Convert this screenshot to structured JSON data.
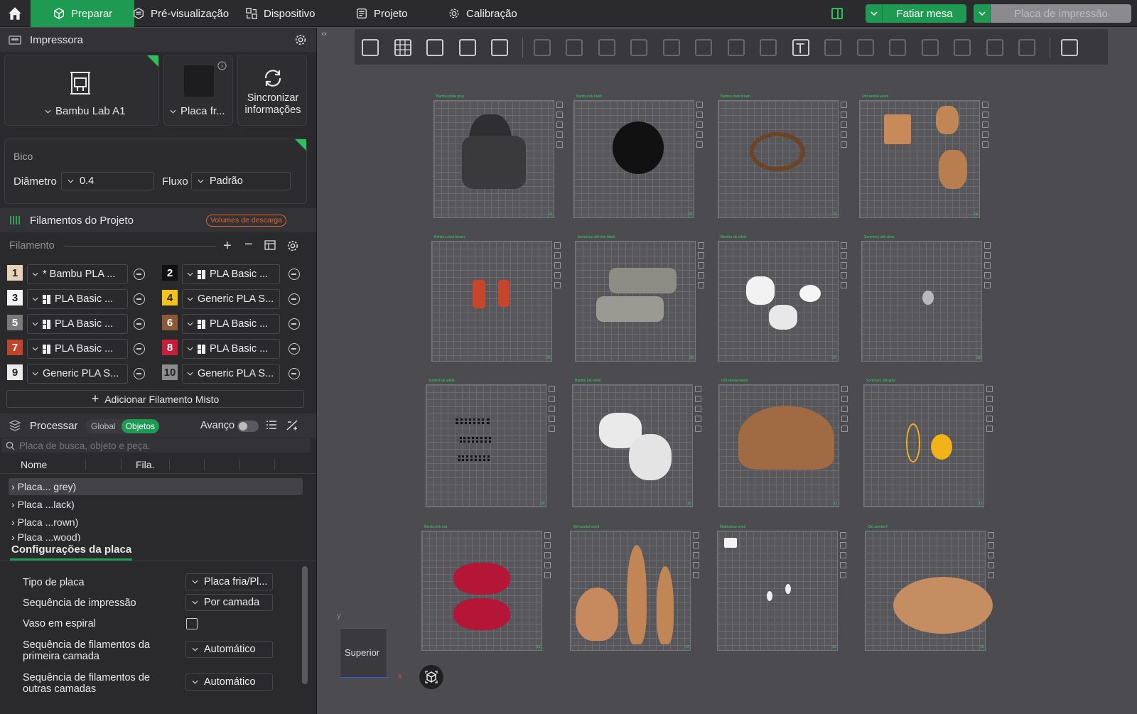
{
  "topbar": {
    "tabs": [
      {
        "label": "Preparar"
      },
      {
        "label": "Pré-visualização"
      },
      {
        "label": "Dispositivo"
      },
      {
        "label": "Projeto"
      },
      {
        "label": "Calibração"
      }
    ],
    "slice_label": "Fatiar mesa",
    "print_label": "Placa de impressão"
  },
  "printer": {
    "header": "Impressora",
    "name": "Bambu Lab A1",
    "plate": "Placa fr...",
    "sync": "Sincronizar informações"
  },
  "nozzle": {
    "title": "Bico",
    "diameter_label": "Diâmetro",
    "diameter_value": "0.4",
    "flow_label": "Fluxo",
    "flow_value": "Padrão"
  },
  "filaments": {
    "header": "Filamentos do Projeto",
    "badge": "Volumes de descarga",
    "sub_label": "Filamento",
    "add_mixed": "Adicionar Filamento Misto",
    "items": [
      {
        "n": "1",
        "name": "* Bambu PLA ...",
        "color": "#e7d3b8",
        "fg": "#222",
        "icon": false
      },
      {
        "n": "2",
        "name": "PLA Basic ...",
        "color": "#101010",
        "fg": "#fff",
        "icon": true
      },
      {
        "n": "3",
        "name": "PLA Basic ...",
        "color": "#f3f3f3",
        "fg": "#222",
        "icon": true
      },
      {
        "n": "4",
        "name": "Generic PLA S...",
        "color": "#f3c21b",
        "fg": "#222",
        "icon": false
      },
      {
        "n": "5",
        "name": "PLA Basic ...",
        "color": "#7a7a7a",
        "fg": "#fff",
        "icon": true
      },
      {
        "n": "6",
        "name": "PLA Basic ...",
        "color": "#8a5a36",
        "fg": "#fff",
        "icon": true
      },
      {
        "n": "7",
        "name": "PLA Basic ...",
        "color": "#c0432b",
        "fg": "#fff",
        "icon": true
      },
      {
        "n": "8",
        "name": "PLA Basic ...",
        "color": "#c51e3a",
        "fg": "#fff",
        "icon": true
      },
      {
        "n": "9",
        "name": "Generic PLA S...",
        "color": "#ebebeb",
        "fg": "#222",
        "icon": false
      },
      {
        "n": "10",
        "name": "Generic PLA S...",
        "color": "#8d8d8d",
        "fg": "#222",
        "icon": false
      }
    ]
  },
  "process": {
    "header": "Processar",
    "global": "Global",
    "objects": "Objetos",
    "advanced": "Avanço",
    "search_placeholder": "Placa de busca, objeto e peça.",
    "col_name": "Nome",
    "col_fila": "Fila.",
    "tree": [
      "Placa... grey)",
      "Placa ...lack)",
      "Placa ...rown)",
      "Placa ...wood)"
    ]
  },
  "plate_settings": {
    "title": "Configurações da placa",
    "rows": [
      {
        "label": "Tipo de placa",
        "value": "Placa fria/Pl..."
      },
      {
        "label": "Sequência de impressão",
        "value": "Por camada"
      },
      {
        "label": "Vaso em espiral",
        "value": ""
      },
      {
        "label": "Sequência de filamentos da primeira camada",
        "value": "Automático"
      },
      {
        "label": "Sequência de filamentos de outras camadas",
        "value": "Automático"
      }
    ]
  },
  "viewport": {
    "view_label": "Superior",
    "axis_x": "x",
    "axis_y": "y",
    "plates": [
      {
        "n": "01",
        "lbl": "Bambu plate grey"
      },
      {
        "n": "02",
        "lbl": "Bambu ink black"
      },
      {
        "n": "03",
        "lbl": "Bambu dark brown"
      },
      {
        "n": "04",
        "lbl": "Old sandal wood"
      },
      {
        "n": "05",
        "lbl": "Bambu coral brown"
      },
      {
        "n": "06",
        "lbl": "Sommory silk iron black"
      },
      {
        "n": "07",
        "lbl": "Bambu ink white"
      },
      {
        "n": "08",
        "lbl": "Sommory silk silver"
      },
      {
        "n": "09",
        "lbl": "Sunted ink white"
      },
      {
        "n": "10",
        "lbl": "Bambu ink white"
      },
      {
        "n": "11",
        "lbl": "Old sandal wood"
      },
      {
        "n": "12",
        "lbl": "Sommory silk gold"
      },
      {
        "n": "13",
        "lbl": "Bambu ink red"
      },
      {
        "n": "14",
        "lbl": "Old sandal wood"
      },
      {
        "n": "15",
        "lbl": "Multicolour eyes"
      },
      {
        "n": "16",
        "lbl": "Old sandal 2"
      }
    ]
  }
}
